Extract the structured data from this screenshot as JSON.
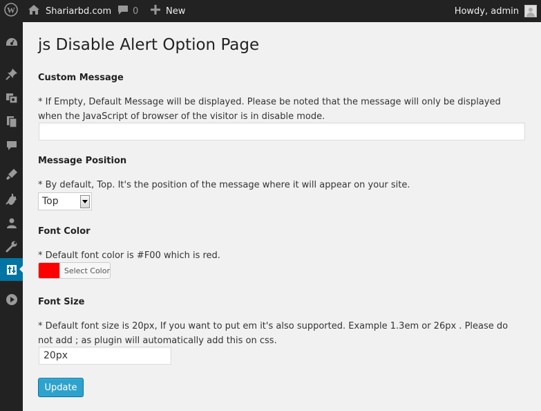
{
  "adminbar": {
    "site_name": "Shariarbd.com",
    "comments_count": "0",
    "new_label": "New",
    "greeting": "Howdy, admin"
  },
  "sidebar": {
    "icons": [
      "dashboard-icon",
      "pin-icon",
      "media-icon",
      "pages-icon",
      "comments-icon",
      "appearance-icon",
      "plugins-icon",
      "users-icon",
      "tools-icon",
      "settings-icon",
      "play-icon"
    ],
    "active": "settings-icon"
  },
  "page": {
    "title": "js Disable Alert Option Page"
  },
  "custom_message": {
    "title": "Custom Message",
    "description": "* If Empty, Default Message will be displayed. Please be noted that the message will only be displayed when the JavaScript of browser of the visitor is in disable mode.",
    "value": ""
  },
  "message_position": {
    "title": "Message Position",
    "description": "* By default, Top. It's the position of the message where it will appear on your site.",
    "selected": "Top"
  },
  "font_color": {
    "title": "Font Color",
    "description": "* Default font color is #F00 which is red.",
    "button_label": "Select Color",
    "color": "#ff0000"
  },
  "font_size": {
    "title": "Font Size",
    "description": "* Default font size is 20px, If you want to put em it's also supported. Example 1.3em or 26px . Please do not add ; as plugin will automatically add this on css.",
    "value": "20px"
  },
  "actions": {
    "update_label": "Update"
  },
  "colors": {
    "adminbar_bg": "#222222",
    "accent": "#0074a2",
    "button": "#2ea2cc",
    "page_bg": "#f1f1f1"
  }
}
